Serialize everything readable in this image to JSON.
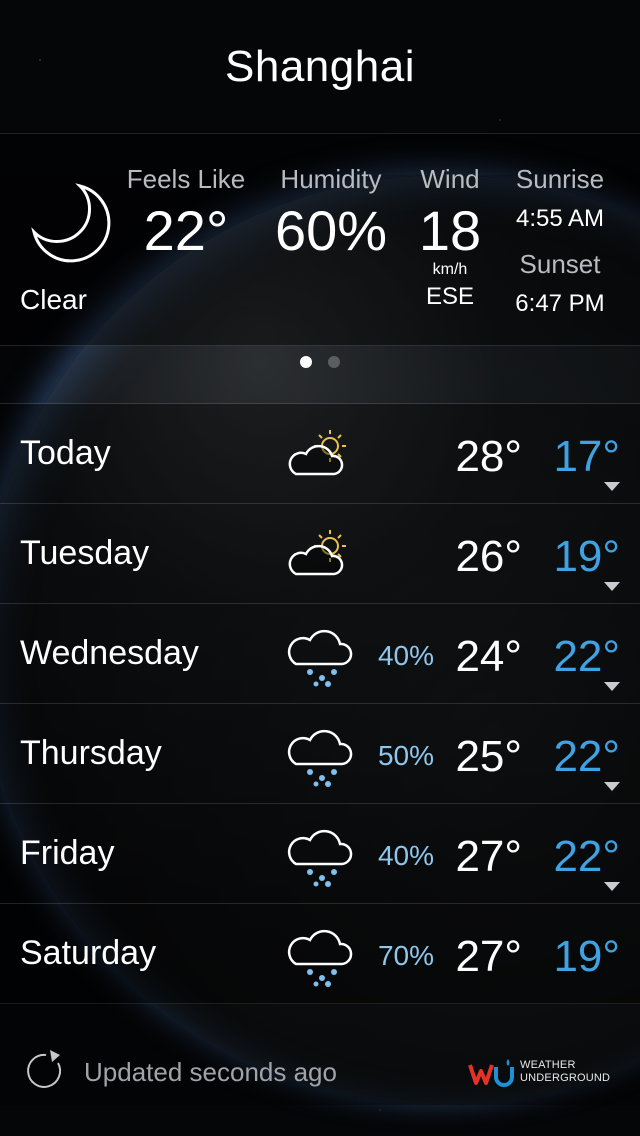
{
  "city": "Shanghai",
  "current": {
    "condition": "Clear",
    "condition_icon": "moon-icon",
    "feels_like_label": "Feels Like",
    "feels_like_value": "22°",
    "humidity_label": "Humidity",
    "humidity_value": "60%",
    "wind_label": "Wind",
    "wind_value": "18",
    "wind_unit": "km/h",
    "wind_direction": "ESE",
    "sunrise_label": "Sunrise",
    "sunrise_time": "4:55 AM",
    "sunset_label": "Sunset",
    "sunset_time": "6:47 PM"
  },
  "pager": {
    "pages": 2,
    "active": 1
  },
  "forecast": [
    {
      "day": "Today",
      "icon": "partly-cloudy-icon",
      "precip": "",
      "high": "28°",
      "low": "17°"
    },
    {
      "day": "Tuesday",
      "icon": "partly-cloudy-icon",
      "precip": "",
      "high": "26°",
      "low": "19°"
    },
    {
      "day": "Wednesday",
      "icon": "rain-icon",
      "precip": "40%",
      "high": "24°",
      "low": "22°"
    },
    {
      "day": "Thursday",
      "icon": "rain-icon",
      "precip": "50%",
      "high": "25°",
      "low": "22°"
    },
    {
      "day": "Friday",
      "icon": "rain-icon",
      "precip": "40%",
      "high": "27°",
      "low": "22°"
    },
    {
      "day": "Saturday",
      "icon": "rain-icon",
      "precip": "70%",
      "high": "27°",
      "low": "19°"
    }
  ],
  "footer": {
    "updated_text": "Updated seconds ago",
    "brand_line1": "WEATHER",
    "brand_line2": "UNDERGROUND"
  },
  "colors": {
    "low_temp": "#3fa3e3",
    "precip": "#8ec6ee",
    "wu_red": "#e4322b",
    "wu_blue": "#1e90d6"
  }
}
